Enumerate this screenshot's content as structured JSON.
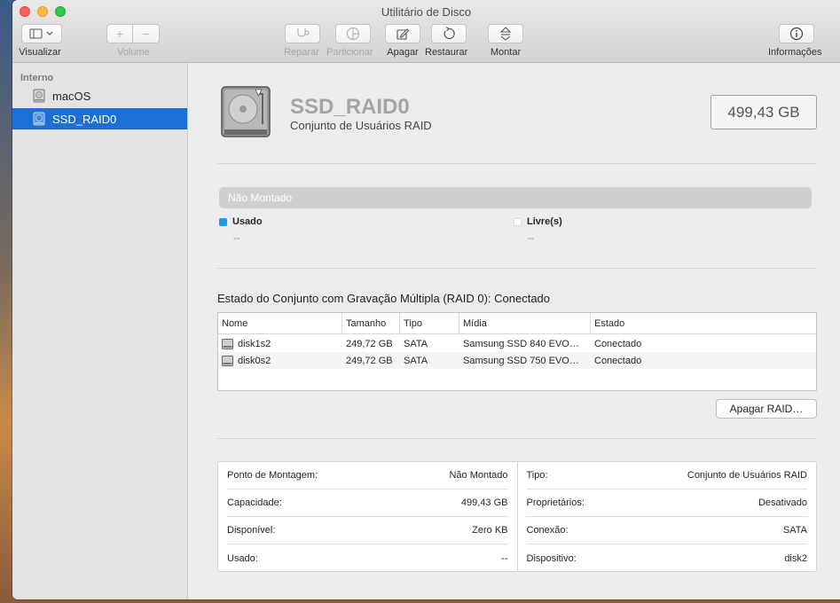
{
  "window": {
    "title": "Utilitário de Disco"
  },
  "toolbar": {
    "view_label": "Visualizar",
    "volume_label": "Volume",
    "volume_add": "+",
    "volume_remove": "−",
    "repair_label": "Reparar",
    "partition_label": "Particionar",
    "erase_label": "Apagar",
    "restore_label": "Restaurar",
    "mount_label": "Montar",
    "info_label": "Informações"
  },
  "sidebar": {
    "section": "Interno",
    "items": [
      {
        "label": "macOS",
        "selected": false
      },
      {
        "label": "SSD_RAID0",
        "selected": true
      }
    ]
  },
  "header": {
    "name": "SSD_RAID0",
    "subtitle": "Conjunto de Usuários RAID",
    "capacity": "499,43 GB"
  },
  "usage": {
    "bar_label": "Não Montado",
    "used_label": "Usado",
    "used_value": "--",
    "used_color": "#1a9cf0",
    "free_label": "Livre(s)",
    "free_value": "--",
    "free_color": "#ffffff"
  },
  "raid": {
    "status_title": "Estado do Conjunto com Gravação Múltipla (RAID 0): Conectado",
    "columns": [
      "Nome",
      "Tamanho",
      "Tipo",
      "Mídia",
      "Estado"
    ],
    "rows": [
      {
        "name": "disk1s2",
        "size": "249,72 GB",
        "type": "SATA",
        "media": "Samsung SSD 840 EVO…",
        "state": "Conectado"
      },
      {
        "name": "disk0s2",
        "size": "249,72 GB",
        "type": "SATA",
        "media": "Samsung SSD 750 EVO…",
        "state": "Conectado"
      }
    ],
    "delete_button": "Apagar RAID…"
  },
  "info": {
    "left": [
      {
        "label": "Ponto de Montagem:",
        "value": "Não Montado"
      },
      {
        "label": "Capacidade:",
        "value": "499,43 GB"
      },
      {
        "label": "Disponível:",
        "value": "Zero KB"
      },
      {
        "label": "Usado:",
        "value": "--"
      }
    ],
    "right": [
      {
        "label": "Tipo:",
        "value": "Conjunto de Usuários RAID"
      },
      {
        "label": "Proprietários:",
        "value": "Desativado"
      },
      {
        "label": "Conexão:",
        "value": "SATA"
      },
      {
        "label": "Dispositivo:",
        "value": "disk2"
      }
    ]
  }
}
